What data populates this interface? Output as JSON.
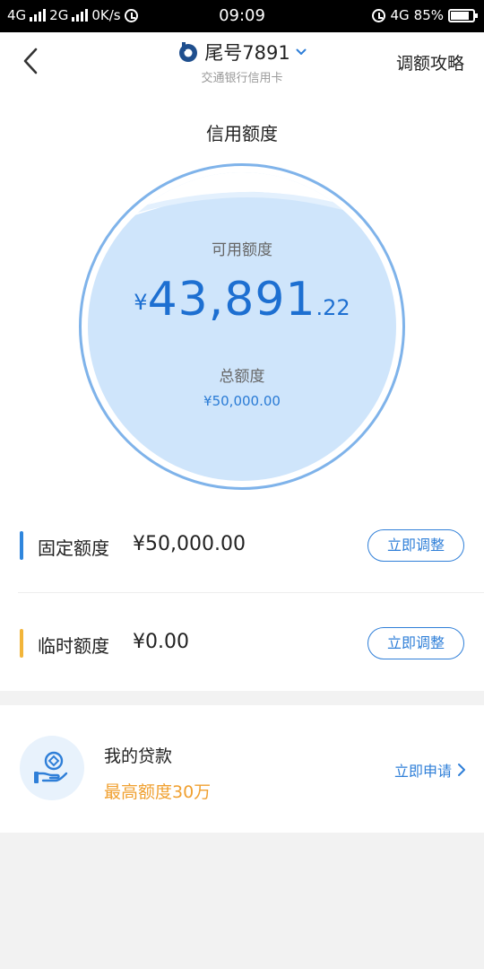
{
  "status_bar": {
    "network1": "4G",
    "network2": "2G",
    "speed": "0K/s",
    "time": "09:09",
    "network3": "4G",
    "battery": "85%",
    "battery_level": 0.85
  },
  "header": {
    "card_label": "尾号7891",
    "bank_name": "交通银行信用卡",
    "strategy_link": "调额攻略"
  },
  "credit": {
    "title": "信用额度",
    "available_label": "可用额度",
    "available_currency": "¥",
    "available_int": "43,891",
    "available_dec": ".22",
    "total_label": "总额度",
    "total_amount": "¥50,000.00"
  },
  "limits": [
    {
      "label": "固定额度",
      "value": "¥50,000.00",
      "button": "立即调整",
      "bar_color": "#2f86dd"
    },
    {
      "label": "临时额度",
      "value": "¥0.00",
      "button": "立即调整",
      "bar_color": "#f2b53a"
    }
  ],
  "loan": {
    "title": "我的贷款",
    "subtitle": "最高额度30万",
    "apply": "立即申请"
  },
  "colors": {
    "accent": "#2f7fd8",
    "circle_fill": "#cfe5fb",
    "orange": "#f0a030"
  }
}
